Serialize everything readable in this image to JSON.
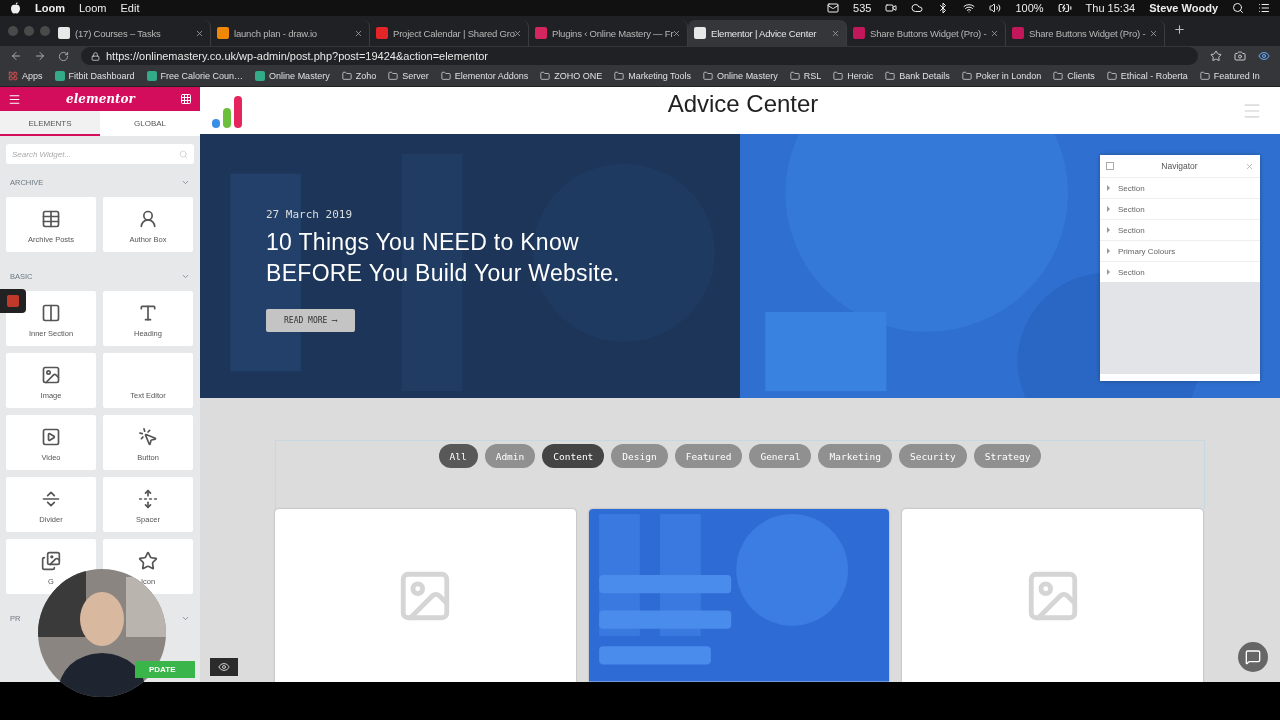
{
  "menubar": {
    "app": "Loom",
    "menus": [
      "Loom",
      "Edit"
    ],
    "mail_count": "535",
    "battery": "100%",
    "clock": "Thu 15:34",
    "user": "Steve Woody"
  },
  "tabs": [
    {
      "title": "(17) Courses – Tasks",
      "selected": false,
      "color": "#e8e8e8"
    },
    {
      "title": "launch plan - draw.io",
      "selected": false,
      "color": "#f08705"
    },
    {
      "title": "Project Calendar | Shared Gro",
      "selected": false,
      "color": "#e42527"
    },
    {
      "title": "Plugins ‹ Online Mastery — Fr",
      "selected": false,
      "color": "#d3265e"
    },
    {
      "title": "Elementor | Advice Center",
      "selected": true,
      "color": "#e8e8e8"
    },
    {
      "title": "Share Buttons Widget (Pro) -",
      "selected": false,
      "color": "#c2185b"
    },
    {
      "title": "Share Buttons Widget (Pro) -",
      "selected": false,
      "color": "#c2185b"
    }
  ],
  "address": "https://onlinemastery.co.uk/wp-admin/post.php?post=19424&action=elementor",
  "bookmarks": [
    {
      "label": "Apps",
      "kind": "apps"
    },
    {
      "label": "Fitbit Dashboard",
      "kind": "site"
    },
    {
      "label": "Free Calorie Coun…",
      "kind": "site"
    },
    {
      "label": "Online Mastery",
      "kind": "site"
    },
    {
      "label": "Zoho",
      "kind": "folder"
    },
    {
      "label": "Server",
      "kind": "folder"
    },
    {
      "label": "Elementor Addons",
      "kind": "folder"
    },
    {
      "label": "ZOHO ONE",
      "kind": "folder"
    },
    {
      "label": "Marketing Tools",
      "kind": "folder"
    },
    {
      "label": "Online Mastery",
      "kind": "folder"
    },
    {
      "label": "RSL",
      "kind": "folder"
    },
    {
      "label": "Heroic",
      "kind": "folder"
    },
    {
      "label": "Bank Details",
      "kind": "folder"
    },
    {
      "label": "Poker in London",
      "kind": "folder"
    },
    {
      "label": "Clients",
      "kind": "folder"
    },
    {
      "label": "Ethical - Roberta",
      "kind": "folder"
    },
    {
      "label": "Featured In",
      "kind": "folder"
    }
  ],
  "editor": {
    "logo": "elementor",
    "tabs": [
      {
        "label": "ELEMENTS",
        "selected": true
      },
      {
        "label": "GLOBAL",
        "selected": false
      }
    ],
    "search": {
      "placeholder": "Search Widget..."
    },
    "categories": [
      {
        "title": "ARCHIVE",
        "expanded": true,
        "widgets": [
          {
            "label": "Archive Posts"
          },
          {
            "label": "Author Box"
          }
        ]
      },
      {
        "title": "BASIC",
        "expanded": true,
        "widgets": [
          {
            "label": "Inner Section"
          },
          {
            "label": "Heading"
          },
          {
            "label": "Image"
          },
          {
            "label": "Text Editor"
          },
          {
            "label": "Video"
          },
          {
            "label": "Button"
          },
          {
            "label": "Divider"
          },
          {
            "label": "Spacer"
          },
          {
            "label": "G"
          },
          {
            "label": "Icon"
          }
        ]
      },
      {
        "title": "PR",
        "expanded": true
      }
    ],
    "update_button": "PDATE"
  },
  "page": {
    "site_title": "Advice Center",
    "hero": {
      "date": "27 March 2019",
      "title": "10 Things You NEED to Know BEFORE You Build Your Website.",
      "button": "READ MORE ⟶"
    },
    "filters": [
      {
        "label": "All",
        "selected": true,
        "hovered": false
      },
      {
        "label": "Admin",
        "selected": false,
        "hovered": false
      },
      {
        "label": "Content",
        "selected": false,
        "hovered": true
      },
      {
        "label": "Design",
        "selected": false,
        "hovered": false
      },
      {
        "label": "Featured",
        "selected": false,
        "hovered": false
      },
      {
        "label": "General",
        "selected": false,
        "hovered": false
      },
      {
        "label": "Marketing",
        "selected": false,
        "hovered": false
      },
      {
        "label": "Security",
        "selected": false,
        "hovered": false
      },
      {
        "label": "Strategy",
        "selected": false,
        "hovered": false
      }
    ],
    "posts": [
      {
        "kind": "placeholder"
      },
      {
        "kind": "picture"
      },
      {
        "kind": "placeholder"
      }
    ]
  },
  "navigator": {
    "title": "Navigator",
    "items": [
      {
        "label": "Section",
        "expanded": false
      },
      {
        "label": "Section",
        "expanded": false
      },
      {
        "label": "Section",
        "expanded": false
      },
      {
        "label": "Primary Colours",
        "expanded": false
      },
      {
        "label": "Section",
        "expanded": false
      }
    ]
  }
}
